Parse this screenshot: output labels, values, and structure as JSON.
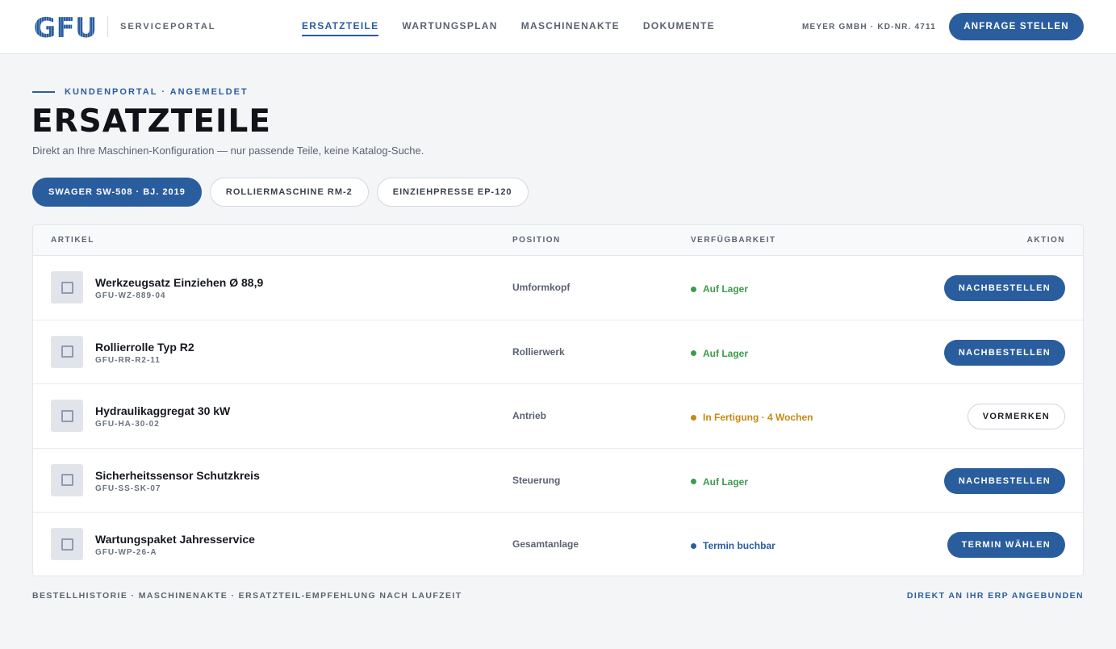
{
  "header": {
    "logo_text": "GFU",
    "portal_name": "SERVICEPORTAL",
    "nav": [
      {
        "label": "ERSATZTEILE",
        "active": true
      },
      {
        "label": "WARTUNGSPLAN",
        "active": false
      },
      {
        "label": "MASCHINENAKTE",
        "active": false
      },
      {
        "label": "DOKUMENTE",
        "active": false
      }
    ],
    "account": "MEYER GMBH · KD-NR. 4711",
    "cta_label": "ANFRAGE STELLEN"
  },
  "hero": {
    "eyebrow": "KUNDENPORTAL · ANGEMELDET",
    "title": "ERSATZTEILE",
    "subtitle": "Direkt an Ihre Maschinen-Konfiguration — nur passende Teile, keine Katalog-Suche."
  },
  "machines": [
    {
      "label": "SWAGER SW-508 · BJ. 2019",
      "active": true
    },
    {
      "label": "ROLLIERMASCHINE RM-2",
      "active": false
    },
    {
      "label": "EINZIEHPRESSE EP-120",
      "active": false
    }
  ],
  "table": {
    "columns": {
      "artikel": "ARTIKEL",
      "position": "POSITION",
      "verfuegbarkeit": "VERFÜGBARKEIT",
      "aktion": "AKTION"
    },
    "rows": [
      {
        "name": "Werkzeugsatz Einziehen Ø 88,9",
        "code": "GFU-WZ-889-04",
        "position": "Umformkopf",
        "availability": "Auf Lager",
        "status_color": "#3f9a4f",
        "action": "NACHBESTELLEN",
        "action_style": "primary"
      },
      {
        "name": "Rollierrolle Typ R2",
        "code": "GFU-RR-R2-11",
        "position": "Rollierwerk",
        "availability": "Auf Lager",
        "status_color": "#3f9a4f",
        "action": "NACHBESTELLEN",
        "action_style": "primary"
      },
      {
        "name": "Hydraulikaggregat 30 kW",
        "code": "GFU-HA-30-02",
        "position": "Antrieb",
        "availability": "In Fertigung · 4 Wochen",
        "status_color": "#c48a12",
        "action": "VORMERKEN",
        "action_style": "secondary"
      },
      {
        "name": "Sicherheitssensor Schutzkreis",
        "code": "GFU-SS-SK-07",
        "position": "Steuerung",
        "availability": "Auf Lager",
        "status_color": "#3f9a4f",
        "action": "NACHBESTELLEN",
        "action_style": "primary"
      },
      {
        "name": "Wartungspaket Jahresservice",
        "code": "GFU-WP-26-A",
        "position": "Gesamtanlage",
        "availability": "Termin buchbar",
        "status_color": "#2a5d9e",
        "action": "TERMIN WÄHLEN",
        "action_style": "primary"
      }
    ]
  },
  "footer": {
    "left": "BESTELLHISTORIE · MASCHINENAKTE · ERSATZTEIL-EMPFEHLUNG NACH LAUFZEIT",
    "right": "DIREKT AN IHR ERP ANGEBUNDEN"
  },
  "colors": {
    "accent": "#2a5d9e",
    "in_stock": "#3f9a4f",
    "in_production": "#c48a12",
    "bookable": "#2a5d9e"
  }
}
